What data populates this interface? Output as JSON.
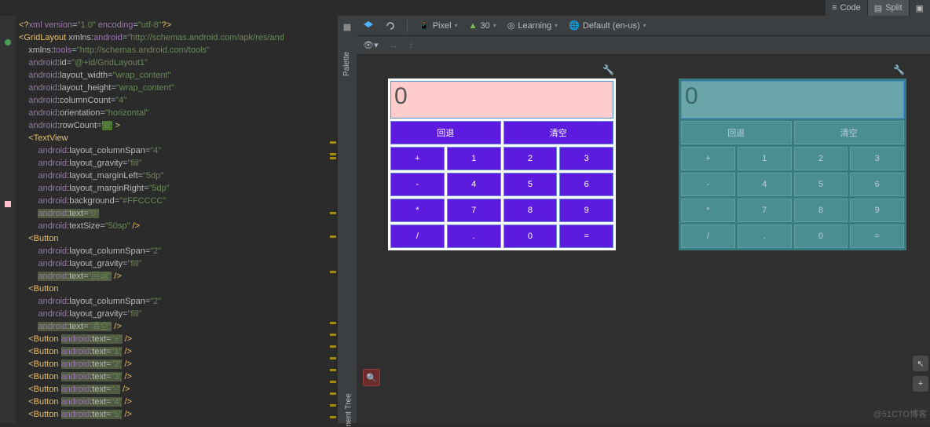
{
  "viewTabs": {
    "code": "Code",
    "split": "Split"
  },
  "code": {
    "l1_a": "<?",
    "l1_b": "xml version",
    "l1_c": "=",
    "l1_d": "\"1.0\"",
    "l1_e": " encoding",
    "l1_f": "=",
    "l1_g": "\"utf-8\"",
    "l1_h": "?>",
    "l2_a": "<GridLayout ",
    "l2_b": "xmlns:",
    "l2_c": "android",
    "l2_d": "=",
    "l2_e": "\"http://schemas.android.com/apk/res/and",
    "l3_a": "    ",
    "l3_b": "xmlns:",
    "l3_c": "tools",
    "l3_d": "=",
    "l3_e": "\"http://schemas.android.com/tools\"",
    "l4_a": "    ",
    "l4_b": "android",
    "l4_c": ":id",
    "l4_d": "=",
    "l4_e": "\"@+id/GridLayout1\"",
    "l5_a": "    ",
    "l5_b": "android",
    "l5_c": ":layout_width",
    "l5_d": "=",
    "l5_e": "\"wrap_content\"",
    "l6_a": "    ",
    "l6_b": "android",
    "l6_c": ":layout_height",
    "l6_d": "=",
    "l6_e": "\"wrap_content\"",
    "l7_a": "    ",
    "l7_b": "android",
    "l7_c": ":columnCount",
    "l7_d": "=",
    "l7_e": "\"4\"",
    "l8_a": "    ",
    "l8_b": "android",
    "l8_c": ":orientation",
    "l8_d": "=",
    "l8_e": "\"horizontal\"",
    "l9_a": "    ",
    "l9_b": "android",
    "l9_c": ":rowCount",
    "l9_d": "=",
    "l9_e": "\"6\"",
    "l9_f": " >",
    "l10_a": "    <TextView",
    "l11_a": "        ",
    "l11_b": "android",
    "l11_c": ":layout_columnSpan",
    "l11_d": "=",
    "l11_e": "\"4\"",
    "l12_a": "        ",
    "l12_b": "android",
    "l12_c": ":layout_gravity",
    "l12_d": "=",
    "l12_e": "\"fill\"",
    "l13_a": "        ",
    "l13_b": "android",
    "l13_c": ":layout_marginLeft",
    "l13_d": "=",
    "l13_e": "\"5dp\"",
    "l14_a": "        ",
    "l14_b": "android",
    "l14_c": ":layout_marginRight",
    "l14_d": "=",
    "l14_e": "\"5dp\"",
    "l15_a": "        ",
    "l15_b": "android",
    "l15_c": ":background",
    "l15_d": "=",
    "l15_e": "\"#FFCCCC\"",
    "l16_a": "        ",
    "l16_b": "android",
    "l16_c": ":text",
    "l16_d": "=",
    "l16_e": "\"0\"",
    "l17_a": "        ",
    "l17_b": "android",
    "l17_c": ":textSize",
    "l17_d": "=",
    "l17_e": "\"50sp\"",
    "l17_f": " />",
    "l18_a": "    <Button",
    "l19_a": "        ",
    "l19_b": "android",
    "l19_c": ":layout_columnSpan",
    "l19_d": "=",
    "l19_e": "\"2\"",
    "l20_a": "        ",
    "l20_b": "android",
    "l20_c": ":layout_gravity",
    "l20_d": "=",
    "l20_e": "\"fill\"",
    "l21_a": "        ",
    "l21_b": "android",
    "l21_c": ":text",
    "l21_d": "=",
    "l21_e": "\"回退\"",
    "l21_f": " />",
    "l22_a": "    <Button",
    "l23_a": "        ",
    "l23_b": "android",
    "l23_c": ":layout_columnSpan",
    "l23_d": "=",
    "l23_e": "\"2\"",
    "l24_a": "        ",
    "l24_b": "android",
    "l24_c": ":layout_gravity",
    "l24_d": "=",
    "l24_e": "\"fill\"",
    "l25_a": "        ",
    "l25_b": "android",
    "l25_c": ":text",
    "l25_d": "=",
    "l25_e": "\"清空\"",
    "l25_f": " />",
    "l26_a": "    <Button ",
    "l26_b": "android",
    "l26_c": ":text",
    "l26_d": "=",
    "l26_e": "\"+\"",
    "l26_f": " />",
    "l27_a": "    <Button ",
    "l27_b": "android",
    "l27_c": ":text",
    "l27_d": "=",
    "l27_e": "\"1\"",
    "l27_f": " />",
    "l28_a": "    <Button ",
    "l28_b": "android",
    "l28_c": ":text",
    "l28_d": "=",
    "l28_e": "\"2\"",
    "l28_f": " />",
    "l29_a": "    <Button ",
    "l29_b": "android",
    "l29_c": ":text",
    "l29_d": "=",
    "l29_e": "\"3\"",
    "l29_f": " />",
    "l30_a": "    <Button ",
    "l30_b": "android",
    "l30_c": ":text",
    "l30_d": "=",
    "l30_e": "\"-\"",
    "l30_f": " />",
    "l31_a": "    <Button ",
    "l31_b": "android",
    "l31_c": ":text",
    "l31_d": "=",
    "l31_e": "\"4\"",
    "l31_f": " />",
    "l32_a": "    <Button ",
    "l32_b": "android",
    "l32_c": ":text",
    "l32_d": "=",
    "l32_e": "\"5\"",
    "l32_f": " />"
  },
  "sidebars": {
    "palette": "Palette",
    "componentTree": "nent Tree"
  },
  "toolbar": {
    "device": "Pixel",
    "api": "30",
    "theme": "Learning",
    "locale": "Default (en-us)"
  },
  "calc": {
    "display": "0",
    "back": "回退",
    "clear": "清空",
    "plus": "+",
    "b1": "1",
    "b2": "2",
    "b3": "3",
    "minus": "-",
    "b4": "4",
    "b5": "5",
    "b6": "6",
    "mul": "*",
    "b7": "7",
    "b8": "8",
    "b9": "9",
    "div": "/",
    "dot": ".",
    "b0": "0",
    "eq": "="
  },
  "watermark": "@51CTO博客"
}
